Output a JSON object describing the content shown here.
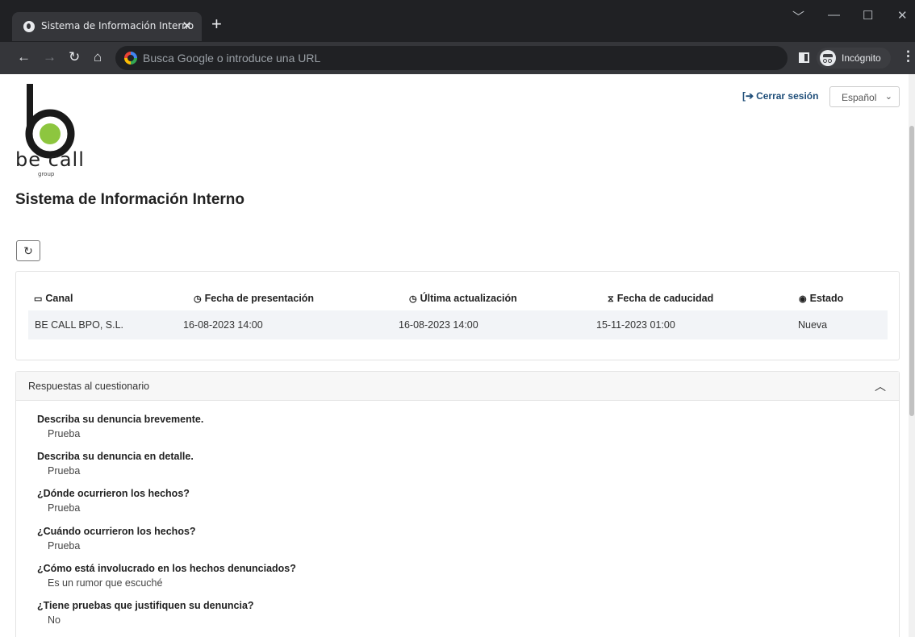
{
  "browser": {
    "tab_title": "Sistema de Información Interno",
    "tab_close": "✕",
    "new_tab": "+",
    "omnibox_placeholder": "Busca Google o introduce una URL",
    "incognito_label": "Incógnito"
  },
  "header": {
    "logo_text": "be call",
    "logo_sub": "group",
    "logout_label": "Cerrar sesión",
    "language_selected": "Español"
  },
  "page_title": "Sistema de Información Interno",
  "table": {
    "headers": [
      "Canal",
      "Fecha de presentación",
      "Última actualización",
      "Fecha de caducidad",
      "Estado"
    ],
    "row": [
      "BE CALL BPO, S.L.",
      "16-08-2023 14:00",
      "16-08-2023 14:00",
      "15-11-2023 01:00",
      "Nueva"
    ]
  },
  "questionnaire": {
    "title": "Respuestas al cuestionario",
    "items": [
      {
        "q": "Describa su denuncia brevemente.",
        "a": "Prueba"
      },
      {
        "q": "Describa su denuncia en detalle.",
        "a": "Prueba"
      },
      {
        "q": "¿Dónde ocurrieron los hechos?",
        "a": "Prueba"
      },
      {
        "q": "¿Cuándo ocurrieron los hechos?",
        "a": "Prueba"
      },
      {
        "q": "¿Cómo está involucrado en los hechos denunciados?",
        "a": "Es un rumor que escuché"
      },
      {
        "q": "¿Tiene pruebas que justifiquen su denuncia?",
        "a": "No"
      }
    ]
  },
  "colors": {
    "accent": "#1f4e79",
    "logo_green": "#8dc63f"
  }
}
